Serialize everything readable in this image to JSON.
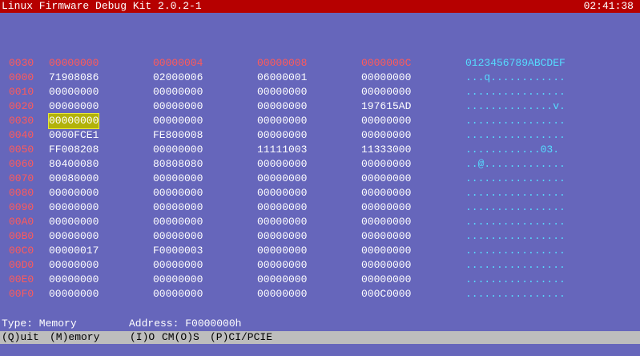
{
  "title": "Linux Firmware Debug Kit 2.0.2-1",
  "clock": "02:41:38",
  "header": {
    "offset": "0030",
    "cols": [
      "00000000",
      "00000004",
      "00000008",
      "0000000C"
    ],
    "ascii": "0123456789ABCDEF"
  },
  "rows": [
    {
      "off": "0000",
      "v": [
        "71908086",
        "02000006",
        "06000001",
        "00000000"
      ],
      "ascii": "...q............"
    },
    {
      "off": "0010",
      "v": [
        "00000000",
        "00000000",
        "00000000",
        "00000000"
      ],
      "ascii": "................"
    },
    {
      "off": "0020",
      "v": [
        "00000000",
        "00000000",
        "00000000",
        "197615AD"
      ],
      "ascii": "..............v."
    },
    {
      "off": "0030",
      "v": [
        "00000000",
        "00000000",
        "00000000",
        "00000000"
      ],
      "ascii": "................"
    },
    {
      "off": "0040",
      "v": [
        "0000FCE1",
        "FE800008",
        "00000000",
        "00000000"
      ],
      "ascii": "................"
    },
    {
      "off": "0050",
      "v": [
        "FF008208",
        "00000000",
        "11111003",
        "11333000"
      ],
      "ascii": "............03."
    },
    {
      "off": "0060",
      "v": [
        "80400080",
        "80808080",
        "00000000",
        "00000000"
      ],
      "ascii": "..@............."
    },
    {
      "off": "0070",
      "v": [
        "00080000",
        "00000000",
        "00000000",
        "00000000"
      ],
      "ascii": "................"
    },
    {
      "off": "0080",
      "v": [
        "00000000",
        "00000000",
        "00000000",
        "00000000"
      ],
      "ascii": "................"
    },
    {
      "off": "0090",
      "v": [
        "00000000",
        "00000000",
        "00000000",
        "00000000"
      ],
      "ascii": "................"
    },
    {
      "off": "00A0",
      "v": [
        "00000000",
        "00000000",
        "00000000",
        "00000000"
      ],
      "ascii": "................"
    },
    {
      "off": "00B0",
      "v": [
        "00000000",
        "00000000",
        "00000000",
        "00000000"
      ],
      "ascii": "................"
    },
    {
      "off": "00C0",
      "v": [
        "00000017",
        "F0000003",
        "00000000",
        "00000000"
      ],
      "ascii": "................"
    },
    {
      "off": "00D0",
      "v": [
        "00000000",
        "00000000",
        "00000000",
        "00000000"
      ],
      "ascii": "................"
    },
    {
      "off": "00E0",
      "v": [
        "00000000",
        "00000000",
        "00000000",
        "00000000"
      ],
      "ascii": "................"
    },
    {
      "off": "00F0",
      "v": [
        "00000000",
        "00000000",
        "00000000",
        "000C0000"
      ],
      "ascii": "................"
    }
  ],
  "status": {
    "type_label": "Type: Memory",
    "address_label": "Address: F0000000h"
  },
  "menu": [
    "(Q)uit",
    "(M)emory",
    "(I)O",
    "CM(O)S",
    "(P)CI/PCIE"
  ]
}
